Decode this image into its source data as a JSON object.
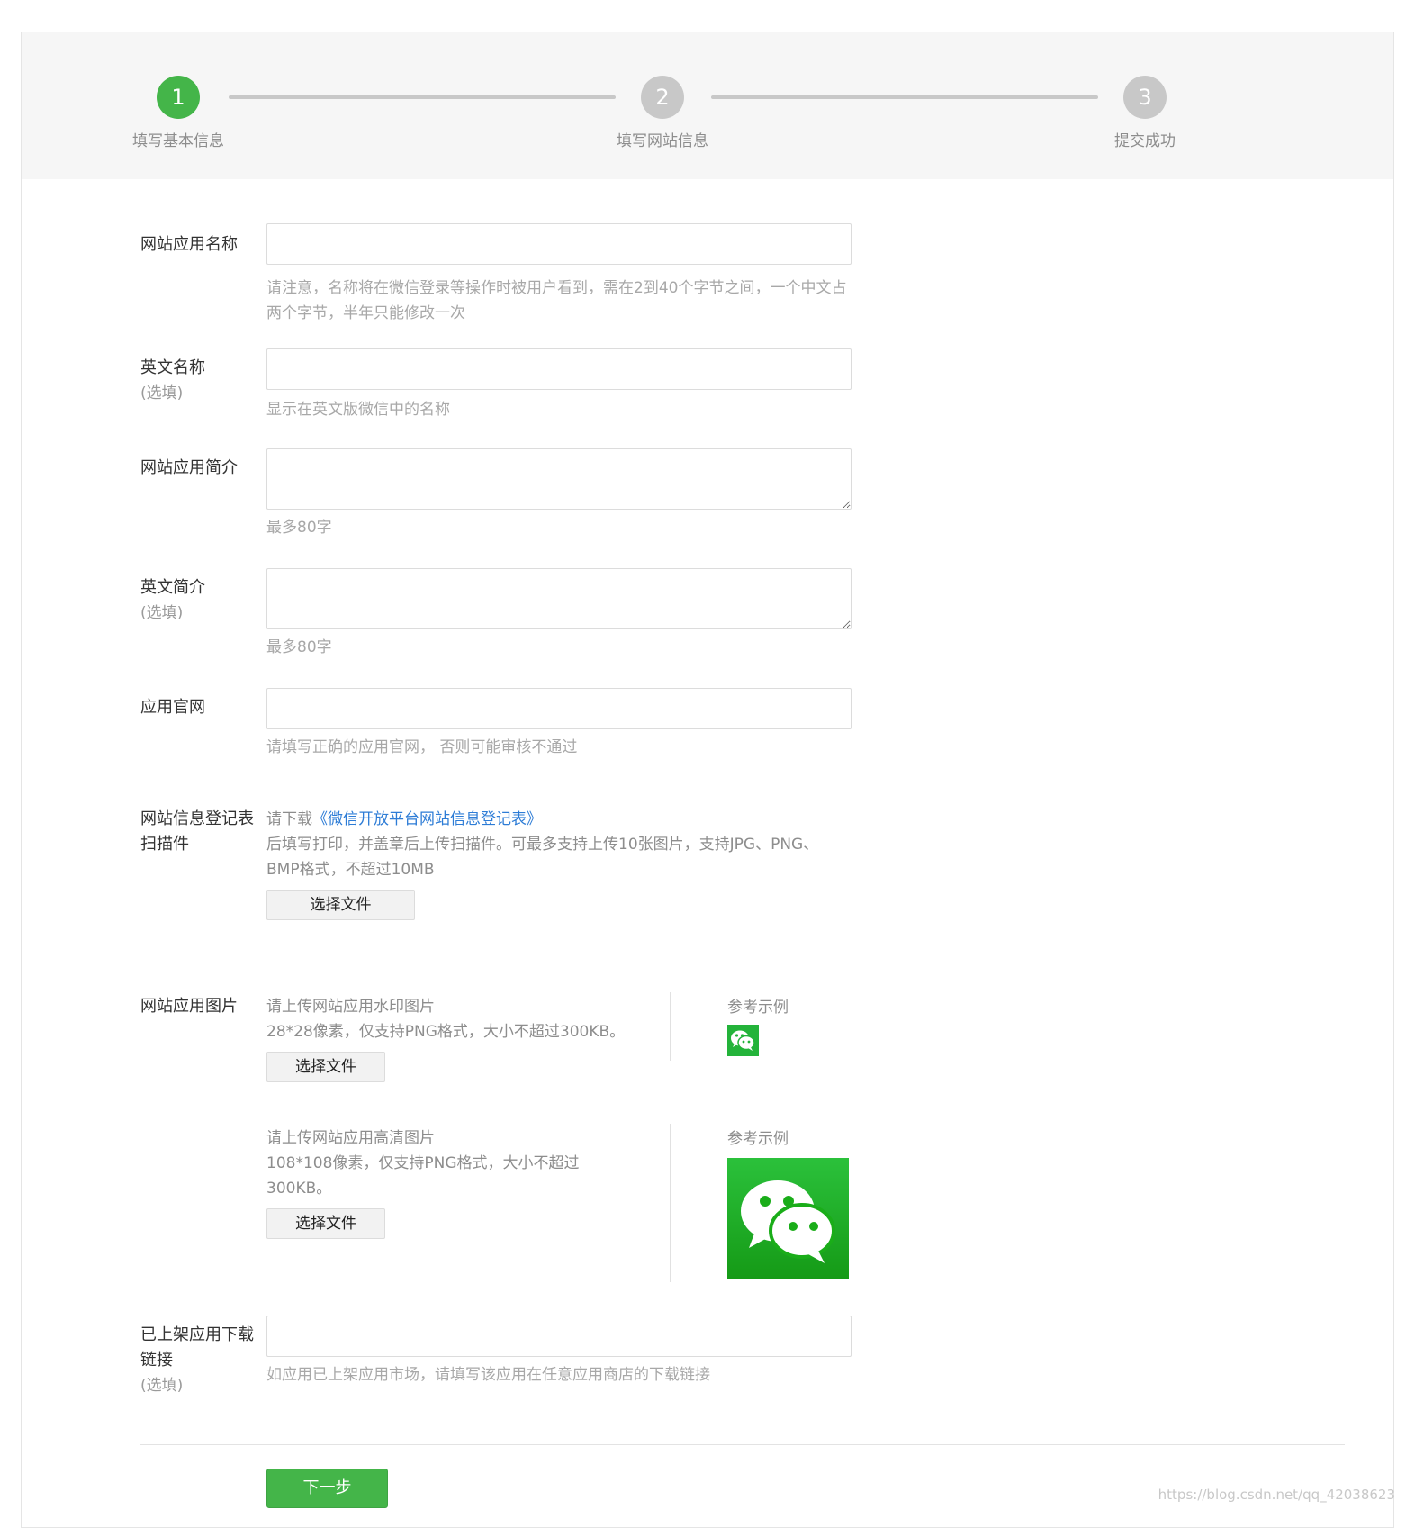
{
  "steps": [
    {
      "number": "1",
      "label": "填写基本信息",
      "active": true
    },
    {
      "number": "2",
      "label": "填写网站信息",
      "active": false
    },
    {
      "number": "3",
      "label": "提交成功",
      "active": false
    }
  ],
  "form": {
    "app_name": {
      "label": "网站应用名称",
      "value": "",
      "hint": "请注意，名称将在微信登录等操作时被用户看到，需在2到40个字节之间，一个中文占两个字节，半年只能修改一次"
    },
    "english_name": {
      "label": "英文名称",
      "optional": "(选填)",
      "value": "",
      "hint": "显示在英文版微信中的名称"
    },
    "app_intro": {
      "label": "网站应用简介",
      "value": "",
      "hint": "最多80字"
    },
    "english_intro": {
      "label": "英文简介",
      "optional": "(选填)",
      "value": "",
      "hint": "最多80字"
    },
    "official_site": {
      "label": "应用官网",
      "value": "",
      "hint": "请填写正确的应用官网， 否则可能审核不通过"
    },
    "registration_scan": {
      "label": "网站信息登记表扫描件",
      "download_prefix": "请下载",
      "download_link": "《微信开放平台网站信息登记表》",
      "instructions": "后填写打印，并盖章后上传扫描件。可最多支持上传10张图片，支持JPG、PNG、BMP格式，不超过10MB",
      "button": "选择文件"
    },
    "app_images": {
      "label": "网站应用图片",
      "watermark": {
        "title": "请上传网站应用水印图片",
        "spec": "28*28像素，仅支持PNG格式，大小不超过300KB。",
        "button": "选择文件",
        "example_label": "参考示例"
      },
      "hd": {
        "title": "请上传网站应用高清图片",
        "spec": "108*108像素，仅支持PNG格式，大小不超过300KB。",
        "button": "选择文件",
        "example_label": "参考示例"
      }
    },
    "download_link": {
      "label": "已上架应用下载链接",
      "optional": "(选填)",
      "value": "",
      "hint": "如应用已上架应用市场，请填写该应用在任意应用商店的下载链接"
    }
  },
  "next_button": "下一步",
  "watermark": "https://blog.csdn.net/qq_42038623",
  "colors": {
    "primary_green": "#44b549",
    "link_blue": "#2d7cd6",
    "wechat_green": "#1aad19"
  }
}
